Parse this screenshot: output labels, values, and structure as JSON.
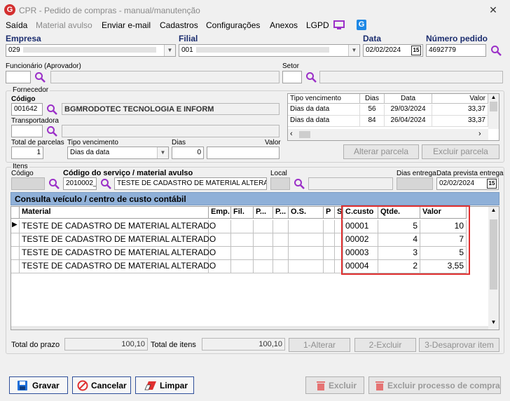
{
  "window": {
    "title": "CPR - Pedido de compras - manual/manutenção",
    "logo": "G",
    "close": "✕"
  },
  "menu": [
    {
      "label": "Saída",
      "enabled": true
    },
    {
      "label": "Material avulso",
      "enabled": false
    },
    {
      "label": "Enviar e-mail",
      "enabled": true
    },
    {
      "label": "Cadastros",
      "enabled": true
    },
    {
      "label": "Configurações",
      "enabled": true
    },
    {
      "label": "Anexos",
      "enabled": true
    },
    {
      "label": "LGPD",
      "enabled": true
    }
  ],
  "header": {
    "empresa_label": "Empresa",
    "empresa_value": "029",
    "filial_label": "Filial",
    "filial_value": "001",
    "data_label": "Data",
    "data_value": "02/02/2024",
    "cal_label": "15",
    "numero_label": "Número pedido",
    "numero_value": "4692779"
  },
  "aprov": {
    "funcionario_label": "Funcionário (Aprovador)",
    "setor_label": "Setor"
  },
  "fornecedor": {
    "title": "Fornecedor",
    "codigo_label": "Código",
    "codigo_value": "001642",
    "nome_value": "BGMRODOTEC TECNOLOGIA E INFORM",
    "transportadora_label": "Transportadora",
    "total_parcelas_label": "Total de parcelas",
    "total_parcelas_value": "1",
    "tipo_venc_label": "Tipo vencimento",
    "tipo_venc_value": "Dias da data",
    "dias_label": "Dias",
    "dias_value": "0",
    "valor_label": "Valor"
  },
  "parcelas": {
    "headers": [
      "Tipo vencimento",
      "Dias",
      "Data",
      "Valor"
    ],
    "rows": [
      [
        "Dias da data",
        "56",
        "29/03/2024",
        "33,37"
      ],
      [
        "Dias da data",
        "84",
        "26/04/2024",
        "33,37"
      ]
    ],
    "alterar_label": "Alterar parcela",
    "excluir_label": "Excluir parcela"
  },
  "itens": {
    "title": "Itens",
    "codigo_label": "Código",
    "servico_label": "Código do serviço / material avulso",
    "servico_code": "2010002_",
    "servico_desc": "TESTE DE CADASTRO DE MATERIAL ALTERAD",
    "local_label": "Local",
    "dias_entrega_label": "Dias entrega",
    "data_prevista_label": "Data prevista entrega",
    "data_prevista_value": "02/02/2024"
  },
  "consulta_title": "Consulta veículo / centro de custo contábil",
  "grid": {
    "headers": [
      "Material",
      "Emp.",
      "Fil.",
      "P...",
      "P...",
      "O.S.",
      "P",
      "S",
      "C.custo",
      "Qtde.",
      "Valor"
    ],
    "rows": [
      {
        "material": "TESTE DE CADASTRO DE MATERIAL ALTERADO",
        "ccusto": "00001",
        "qtde": "5",
        "valor": "10"
      },
      {
        "material": "TESTE DE CADASTRO DE MATERIAL ALTERADO",
        "ccusto": "00002",
        "qtde": "4",
        "valor": "7"
      },
      {
        "material": "TESTE DE CADASTRO DE MATERIAL ALTERADO",
        "ccusto": "00003",
        "qtde": "3",
        "valor": "5"
      },
      {
        "material": "TESTE DE CADASTRO DE MATERIAL ALTERADO",
        "ccusto": "00004",
        "qtde": "2",
        "valor": "3,55"
      }
    ]
  },
  "totals": {
    "prazo_label": "Total do prazo",
    "prazo_value": "100,10",
    "itens_label": "Total de itens",
    "itens_value": "100,10",
    "alterar_label": "1-Alterar",
    "excluir_label": "2-Excluir",
    "desaprovar_label": "3-Desaprovar item"
  },
  "footer": {
    "gravar": "Gravar",
    "cancelar": "Cancelar",
    "limpar": "Limpar",
    "excluir": "Excluir",
    "excluir_processo": "Excluir processo de compra"
  },
  "colors": {
    "accent": "#1a2c6e",
    "highlight": "#e03030",
    "grid_header": "#8fb0d8",
    "magnifier": "#9b30c8"
  }
}
